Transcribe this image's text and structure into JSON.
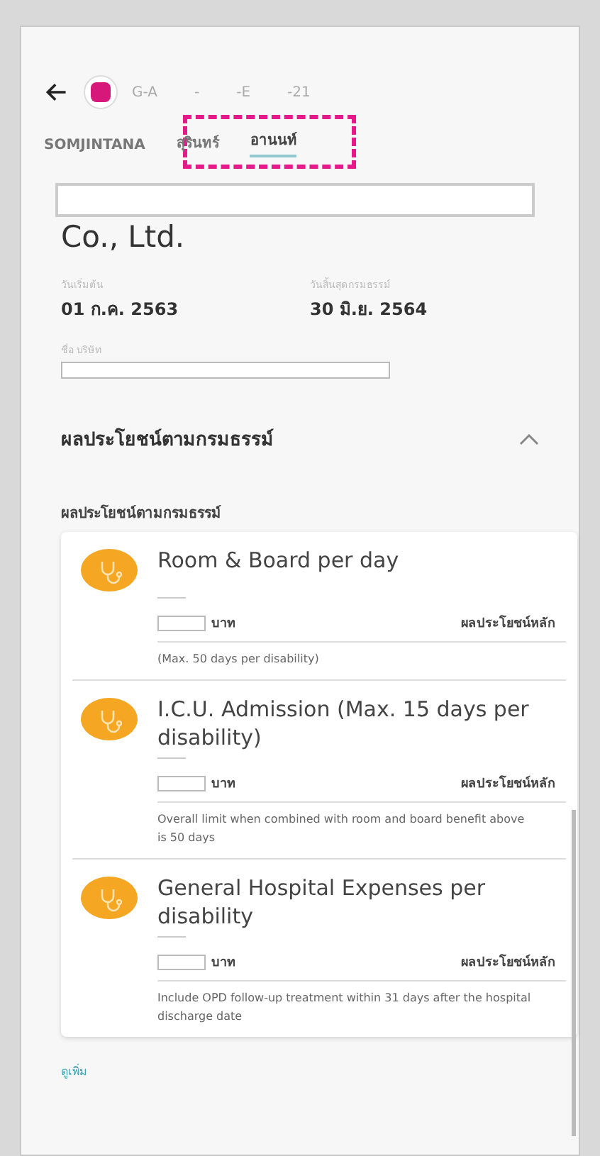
{
  "header": {
    "policy_number_parts": [
      "G-A",
      "-",
      "-E",
      "-21"
    ]
  },
  "tabs": [
    {
      "label": "SOMJINTANA",
      "selected": false
    },
    {
      "label": "สุรินทร์",
      "selected": false
    },
    {
      "label": "อานนท์",
      "selected": true
    }
  ],
  "company": {
    "name_suffix": "Co., Ltd."
  },
  "dates": [
    {
      "label": "วันเริ่มต้น",
      "value": "01 ก.ค. 2563"
    },
    {
      "label": "วันสิ้นสุดกรมธรรม์",
      "value": "30 มิ.ย. 2564"
    }
  ],
  "company_field": {
    "label": "ชื่อ บริษัท"
  },
  "section": {
    "title": "ผลประโยชน์ตามกรมธรรม์",
    "expanded": true,
    "subtitle": "ผลประโยชน์ตามกรมธรรม์"
  },
  "benefits": [
    {
      "title": "Room & Board per day",
      "unit": "บาท",
      "type": "ผลประโยชน์หลัก",
      "note": "(Max. 50 days per disability)"
    },
    {
      "title": "I.C.U. Admission (Max. 15 days per disability)",
      "unit": "บาท",
      "type": "ผลประโยชน์หลัก",
      "note": "Overall limit when combined with room and board benefit above is 50 days"
    },
    {
      "title": "General Hospital Expenses per disability",
      "unit": "บาท",
      "type": "ผลประโยชน์หลัก",
      "note": "Include OPD follow-up treatment within 31 days after the hospital discharge date"
    }
  ],
  "more_link": "ดูเพิ่ม"
}
